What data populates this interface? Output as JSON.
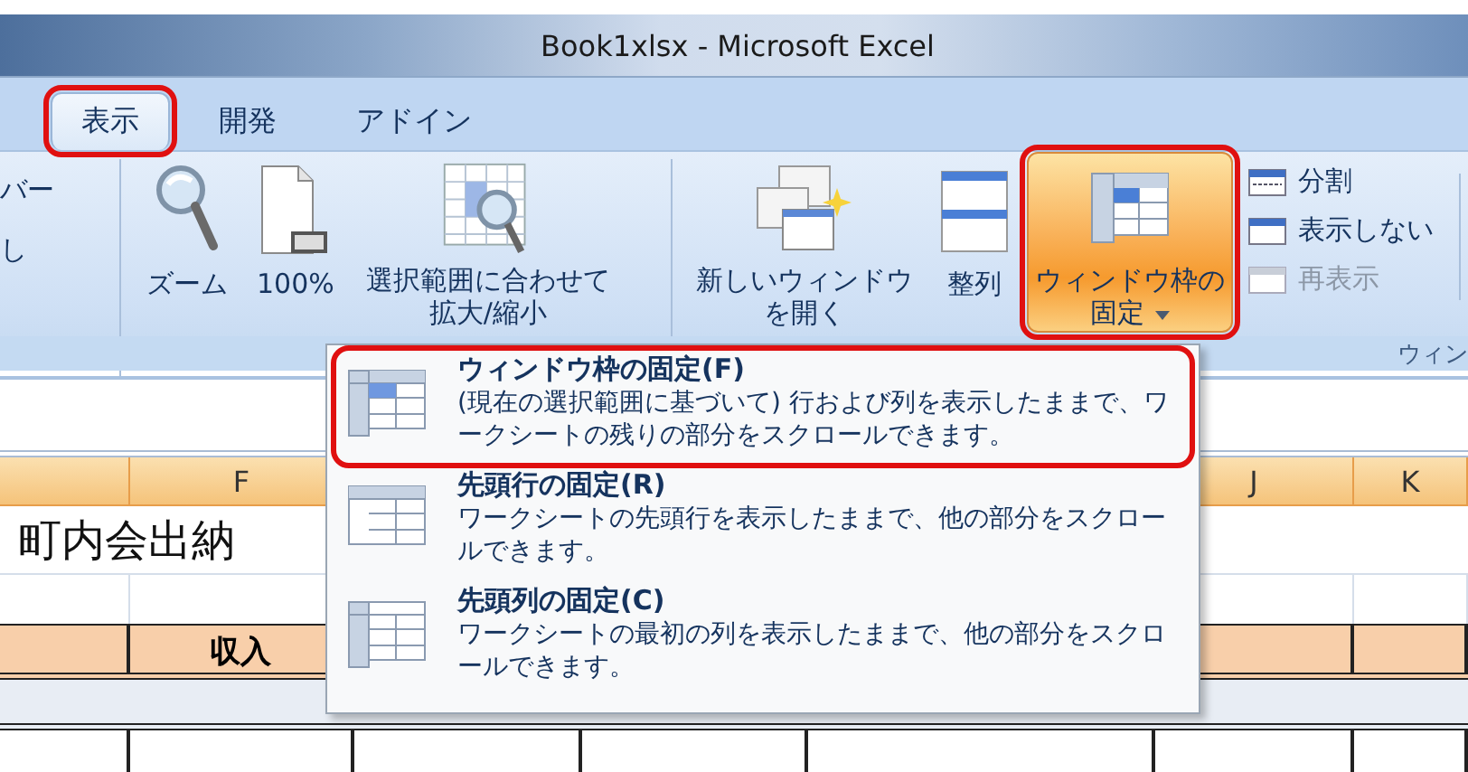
{
  "window": {
    "title": "Book1xlsx - Microsoft Excel"
  },
  "tabs": [
    {
      "label": "表示",
      "selected": true,
      "highlighted": true
    },
    {
      "label": "開発",
      "selected": false,
      "highlighted": false
    },
    {
      "label": "アドイン",
      "selected": false,
      "highlighted": false
    }
  ],
  "ribbon": {
    "partial_group": {
      "items": [
        "バー",
        "し"
      ]
    },
    "zoom_group": {
      "buttons": [
        {
          "kind": "zoom",
          "label": "ズーム"
        },
        {
          "kind": "hundred",
          "label": "100%"
        },
        {
          "kind": "fit",
          "label": "選択範囲に合わせて拡大/縮小"
        }
      ]
    },
    "window_group": {
      "label": "ウィン",
      "buttons": [
        {
          "kind": "new-window",
          "label": "新しいウィンドウを開く",
          "highlighted": false
        },
        {
          "kind": "arrange",
          "label": "整列",
          "highlighted": false
        },
        {
          "kind": "freeze",
          "label": "ウィンドウ枠の固定",
          "highlighted": true
        }
      ],
      "small_buttons": [
        {
          "kind": "split",
          "label": "分割",
          "disabled": false
        },
        {
          "kind": "hide",
          "label": "表示しない",
          "disabled": false
        },
        {
          "kind": "unhide",
          "label": "再表示",
          "disabled": true
        }
      ]
    }
  },
  "sheet": {
    "columns": [
      {
        "label": "F"
      },
      {
        "label": "J"
      },
      {
        "label": "K"
      }
    ],
    "title_cell": "町内会出納",
    "header_cell": "収入"
  },
  "dropdown": {
    "items": [
      {
        "kind": "panes",
        "title": "ウィンドウ枠の固定(F)",
        "description": "(現在の選択範囲に基づいて) 行および列を表示したままで、ワークシートの残りの部分をスクロールできます。",
        "highlighted": true
      },
      {
        "kind": "row",
        "title": "先頭行の固定(R)",
        "description": "ワークシートの先頭行を表示したままで、他の部分をスクロールできます。",
        "highlighted": false
      },
      {
        "kind": "column",
        "title": "先頭列の固定(C)",
        "description": "ワークシートの最初の列を表示したままで、他の部分をスクロールできます。",
        "highlighted": false
      }
    ]
  }
}
